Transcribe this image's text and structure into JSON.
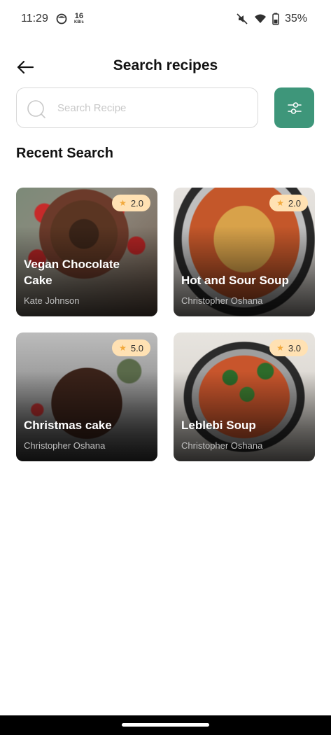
{
  "status_bar": {
    "time": "11:29",
    "net_speed_value": "16",
    "net_speed_unit": "KB/s",
    "battery": "35%",
    "icons": [
      "face-icon",
      "mute-icon",
      "wifi-icon",
      "battery-icon"
    ]
  },
  "header": {
    "title": "Search recipes",
    "back_icon": "arrow-left-icon"
  },
  "search": {
    "placeholder": "Search Recipe",
    "value": "",
    "filter_icon": "sliders-icon",
    "filter_color": "#3e967a"
  },
  "recent": {
    "title": "Recent Search",
    "items": [
      {
        "title": "Vegan Chocolate Cake",
        "author": "Kate Johnson",
        "rating": "2.0"
      },
      {
        "title": "Hot and Sour Soup",
        "author": "Christopher Oshana",
        "rating": "2.0"
      },
      {
        "title": "Christmas cake",
        "author": "Christopher Oshana",
        "rating": "5.0"
      },
      {
        "title": "Leblebi Soup",
        "author": "Christopher Oshana",
        "rating": "3.0"
      }
    ]
  },
  "colors": {
    "accent": "#3e967a",
    "rating_badge": "#ffe1b3",
    "star": "#f2a93b"
  }
}
